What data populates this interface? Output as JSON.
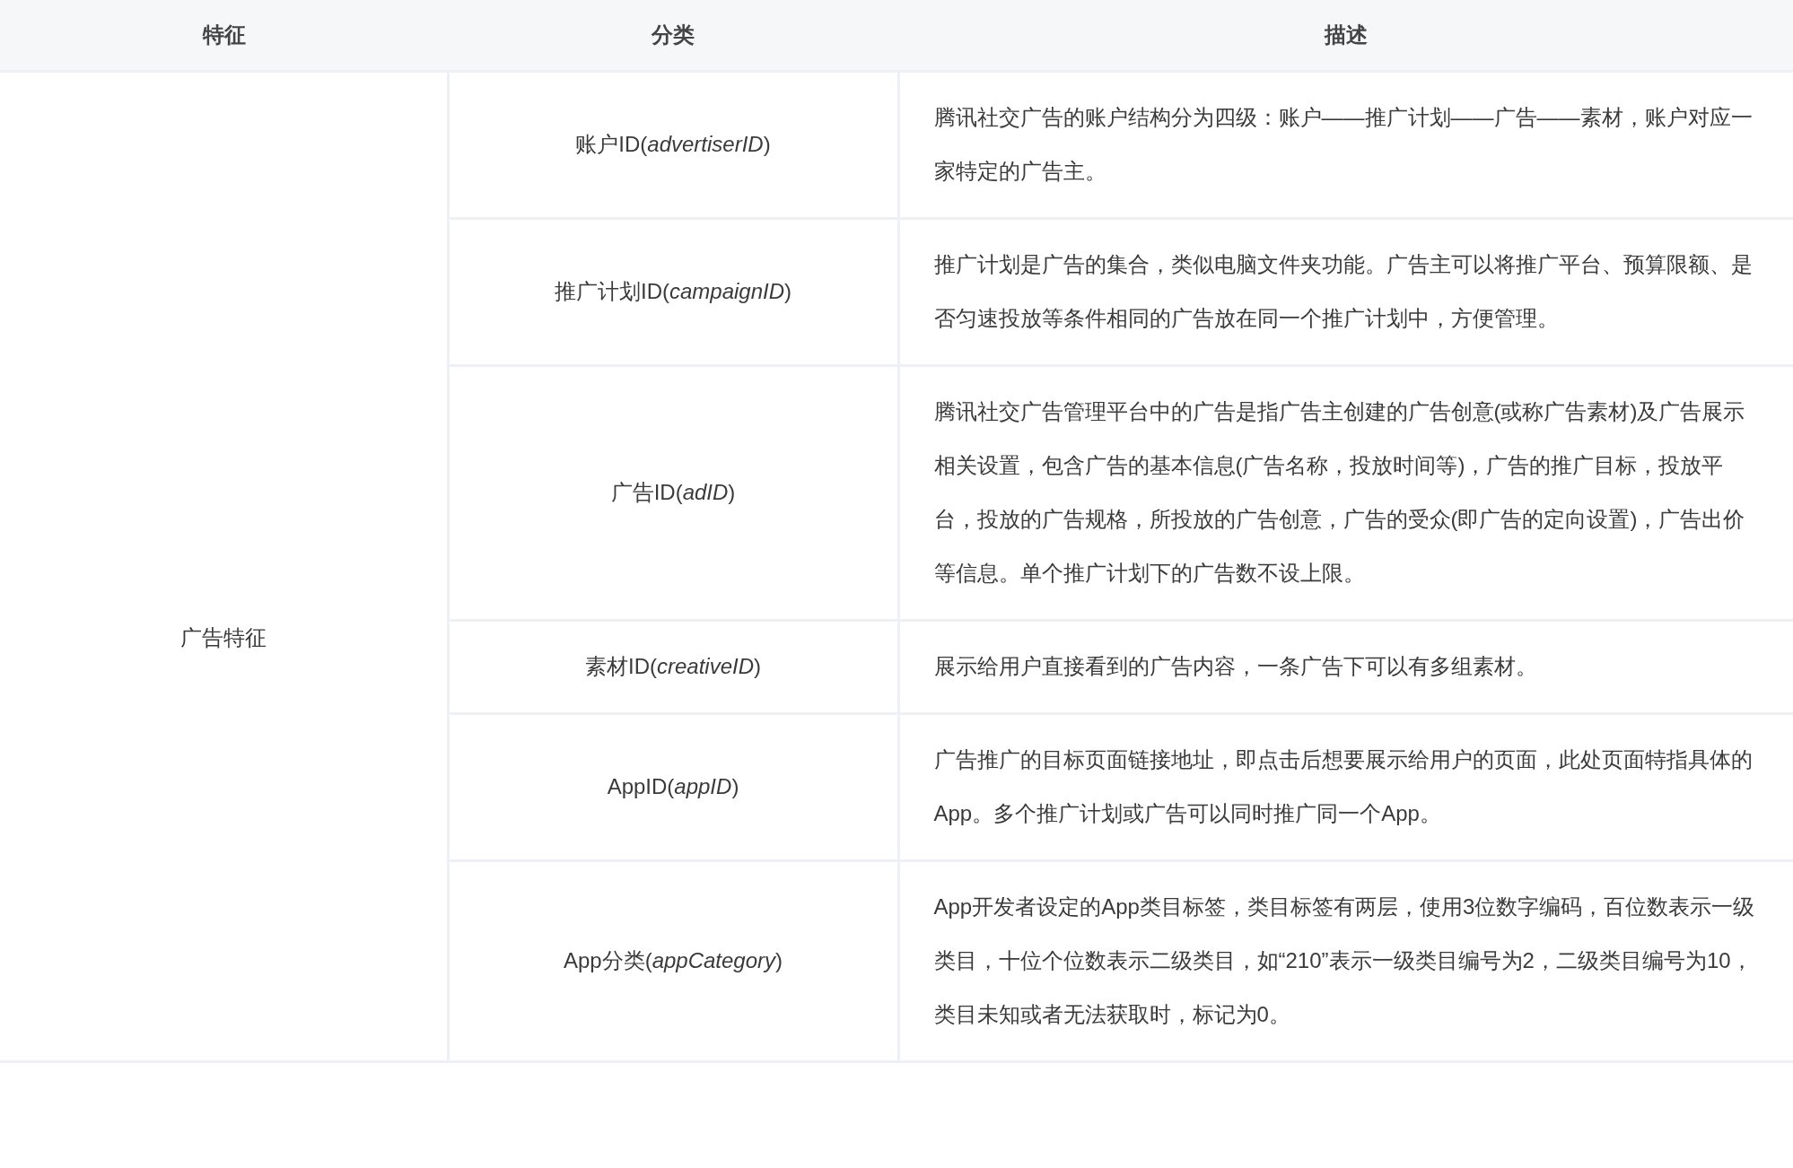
{
  "table": {
    "columns": [
      "特征",
      "分类",
      "描述"
    ],
    "group": "广告特征",
    "rows": [
      {
        "category": "账户ID(*advertiserID*)",
        "description": "腾讯社交广告的账户结构分为四级：账户——推广计划——广告——素材，账户对应一家特定的广告主。"
      },
      {
        "category": "推广计划ID(*campaignID*)",
        "description": "推广计划是广告的集合，类似电脑文件夹功能。广告主可以将推广平台、预算限额、是否匀速投放等条件相同的广告放在同一个推广计划中，方便管理。"
      },
      {
        "category": "广告ID(*adID*)",
        "description": "腾讯社交广告管理平台中的广告是指广告主创建的广告创意(或称广告素材)及广告展示相关设置，包含广告的基本信息(广告名称，投放时间等)，广告的推广目标，投放平台，投放的广告规格，所投放的广告创意，广告的受众(即广告的定向设置)，广告出价等信息。单个推广计划下的广告数不设上限。"
      },
      {
        "category": "素材ID(*creativeID*)",
        "description": "展示给用户直接看到的广告内容，一条广告下可以有多组素材。"
      },
      {
        "category": "AppID(*appID*)",
        "description": "广告推广的目标页面链接地址，即点击后想要展示给用户的页面，此处页面特指具体的App。多个推广计划或广告可以同时推广同一个App。"
      },
      {
        "category": "App分类(*appCategory*)",
        "description": "App开发者设定的App类目标签，类目标签有两层，使用3位数字编码，百位数表示一级类目，十位个位数表示二级类目，如“210”表示一级类目编号为2，二级类目编号为10，类目未知或者无法获取时，标记为0。"
      }
    ]
  }
}
